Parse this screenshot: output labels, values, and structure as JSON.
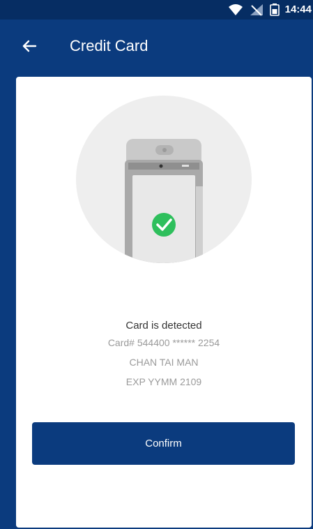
{
  "status_bar": {
    "time": "14:44",
    "icons": [
      "wifi-icon",
      "no-signal-icon",
      "battery-icon"
    ]
  },
  "header": {
    "back_icon": "arrow-left-icon",
    "title": "Credit Card"
  },
  "card": {
    "illustration": {
      "icon": "card-terminal-icon",
      "status_icon": "check-circle-icon"
    },
    "detected_text": "Card is detected",
    "card_number": "Card# 544400 ****** 2254",
    "card_holder": "CHAN TAI MAN",
    "expiry": "EXP YYMM 2109"
  },
  "actions": {
    "confirm_label": "Confirm"
  },
  "colors": {
    "primary": "#0b3b7e",
    "status_bar": "#062d63",
    "success": "#2ebf5c",
    "surface": "#ffffff"
  }
}
